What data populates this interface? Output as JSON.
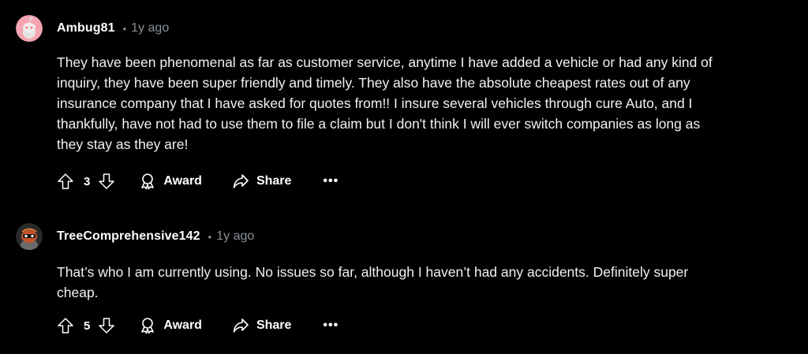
{
  "colors": {
    "background": "#000000",
    "text": "#f2f2f2",
    "meta": "#8a9197",
    "avatar1": "#f4a3b1",
    "avatar2": "#c6532a"
  },
  "comments": [
    {
      "username": "Ambug81",
      "separator": "•",
      "time": "1y ago",
      "avatar_icon": "snoo-avatar-icon",
      "body_lines": [
        "They have been phenomenal as far as customer service, anytime I have added a vehicle or had any kind of",
        "inquiry, they have been super friendly and timely. They also have the absolute cheapest rates out of any",
        "insurance company that I have asked for quotes from!! I insure several vehicles through cure Auto, and I",
        "thankfully, have not had to use them to file a claim but I don't think I will ever switch companies as long as",
        "they stay as they are!"
      ],
      "votes": "3",
      "award_label": "Award",
      "share_label": "Share",
      "more_label": "•••"
    },
    {
      "username": "TreeComprehensive142",
      "separator": "•",
      "time": "1y ago",
      "avatar_icon": "custom-snoo-avatar-icon",
      "body_lines": [
        "That’s who I am currently using. No issues so far, although I haven’t had any accidents. Definitely super",
        "cheap."
      ],
      "votes": "5",
      "award_label": "Award",
      "share_label": "Share",
      "more_label": "•••"
    }
  ]
}
